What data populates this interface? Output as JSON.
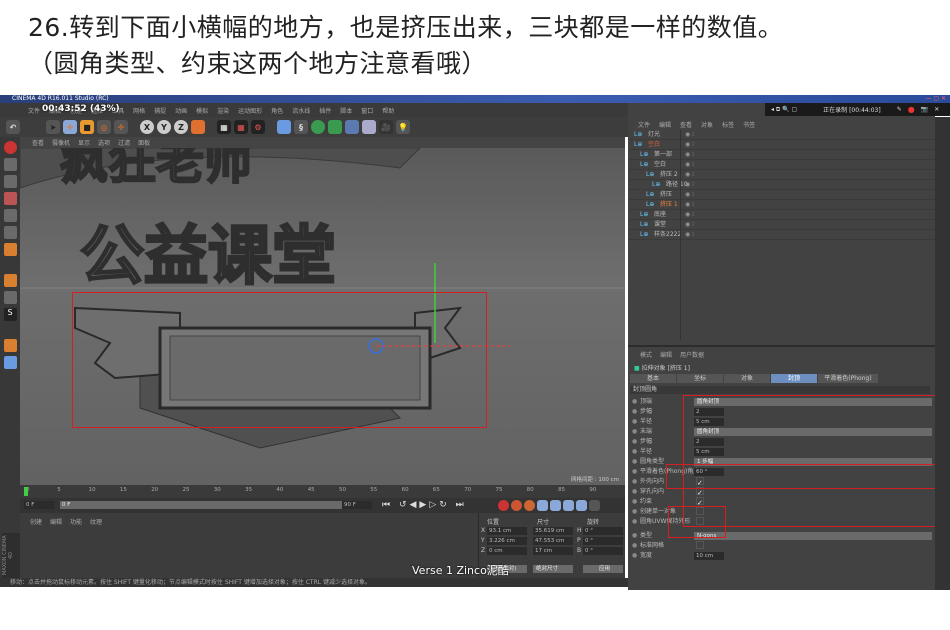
{
  "caption": {
    "line1": "26.转到下面小横幅的地方，也是挤压出来，三块都是一样的数值。",
    "line2": "（圆角类型、约束这两个地方注意看哦）"
  },
  "window": {
    "title": "CINEMA 4D R16.011 Studio (RC)",
    "timer": "00:43:52 (43%)",
    "menu": [
      "文件",
      "编辑",
      "创建",
      "选择",
      "工具",
      "网格",
      "捕捉",
      "动画",
      "模拟",
      "渲染",
      "运动图形",
      "角色",
      "流水线",
      "插件",
      "脚本",
      "窗口",
      "帮助"
    ]
  },
  "toolbar": {
    "axes": [
      "X",
      "Y",
      "Z"
    ]
  },
  "viewport": {
    "menu": [
      "查看",
      "摄像机",
      "显示",
      "选项",
      "过滤",
      "面板"
    ],
    "grid_label": "网格间距 : 100 cm"
  },
  "timeline": {
    "ticks": [
      "0",
      "5",
      "10",
      "15",
      "20",
      "25",
      "30",
      "35",
      "40",
      "45",
      "50",
      "55",
      "60",
      "65",
      "70",
      "75",
      "80",
      "85",
      "90"
    ],
    "start": "0 F",
    "end": "90 F",
    "current": "0 F"
  },
  "material": {
    "menu": [
      "创建",
      "编辑",
      "功能",
      "纹理"
    ]
  },
  "coords": {
    "headers": [
      "位置",
      "尺寸",
      "旋转"
    ],
    "rows": [
      {
        "axis": "X",
        "pos": "93.1 cm",
        "size": "35.619 cm",
        "rl": "H",
        "rot": "0 °"
      },
      {
        "axis": "Y",
        "pos": "3.226 cm",
        "size": "47.553 cm",
        "rl": "P",
        "rot": "0 °"
      },
      {
        "axis": "Z",
        "pos": "0 cm",
        "size": "17 cm",
        "rl": "B",
        "rot": "0 °"
      }
    ],
    "mode1": "对象(相对)",
    "mode2": "绝对尺寸",
    "apply": "应用"
  },
  "status": "移动：点击并拖动鼠标移动元素。按住 SHIFT 键量化移动；节点编辑模式时按住 SHIFT 键增加选择对象；按住 CTRL 键减少选择对象。",
  "watermark": "Verse 1 Zinco泥酷",
  "recorder": {
    "text": "正在录制 [00:44:03]"
  },
  "object_manager": {
    "menu": [
      "文件",
      "编辑",
      "查看",
      "对象",
      "标签",
      "书签"
    ],
    "objects": [
      {
        "name": "灯光",
        "indent": 0,
        "color": "#bbb"
      },
      {
        "name": "空白",
        "indent": 0,
        "color": "#e06040"
      },
      {
        "name": "第一部",
        "indent": 1,
        "color": "#bbb"
      },
      {
        "name": "空白",
        "indent": 1,
        "color": "#bbb"
      },
      {
        "name": "挤压 2",
        "indent": 2,
        "color": "#bbb"
      },
      {
        "name": "路径 10",
        "indent": 3,
        "color": "#bbb"
      },
      {
        "name": "挤压",
        "indent": 2,
        "color": "#bbb"
      },
      {
        "name": "挤压 1",
        "indent": 2,
        "color": "#f08040"
      },
      {
        "name": "底座",
        "indent": 1,
        "color": "#bbb"
      },
      {
        "name": "课堂",
        "indent": 1,
        "color": "#bbb"
      },
      {
        "name": "样条2222",
        "indent": 1,
        "color": "#bbb"
      }
    ]
  },
  "attributes": {
    "menu": [
      "模式",
      "编辑",
      "用户数据"
    ],
    "object_title": "拉伸对象 [挤压 1]",
    "tabs": [
      "基本",
      "坐标",
      "对象",
      "封顶",
      "平滑着色(Phong)"
    ],
    "active_tab": 3,
    "section": "封顶圆角",
    "rows": [
      {
        "label": "顶端",
        "type": "drop",
        "value": "圆角封顶"
      },
      {
        "label": "步幅",
        "type": "num",
        "value": "2"
      },
      {
        "label": "半径",
        "type": "num",
        "value": "5 cm"
      },
      {
        "label": "末端",
        "type": "drop",
        "value": "圆角封顶"
      },
      {
        "label": "步幅",
        "type": "num",
        "value": "2"
      },
      {
        "label": "半径",
        "type": "num",
        "value": "5 cm"
      },
      {
        "label": "圆角类型",
        "type": "drop",
        "value": "1 步幅"
      },
      {
        "label": "平滑着色(Phong)角度",
        "type": "num",
        "value": "60 °"
      },
      {
        "label": "外壳向内",
        "type": "chk",
        "value": "✓"
      },
      {
        "label": "穿孔向内",
        "type": "chk",
        "value": "✓"
      },
      {
        "label": "约束",
        "type": "chk",
        "value": "✓"
      },
      {
        "label": "创建单一对象",
        "type": "chk",
        "value": ""
      },
      {
        "label": "圆角UVW保持外形",
        "type": "chk",
        "value": ""
      },
      {
        "label": "类型",
        "type": "drop",
        "value": "N-gons"
      },
      {
        "label": "标准网格",
        "type": "chk",
        "value": ""
      },
      {
        "label": "宽度",
        "type": "num",
        "value": "10 cm"
      }
    ]
  },
  "colors": {
    "highlight": "#d42020",
    "active_tab": "#6d8fc0"
  }
}
